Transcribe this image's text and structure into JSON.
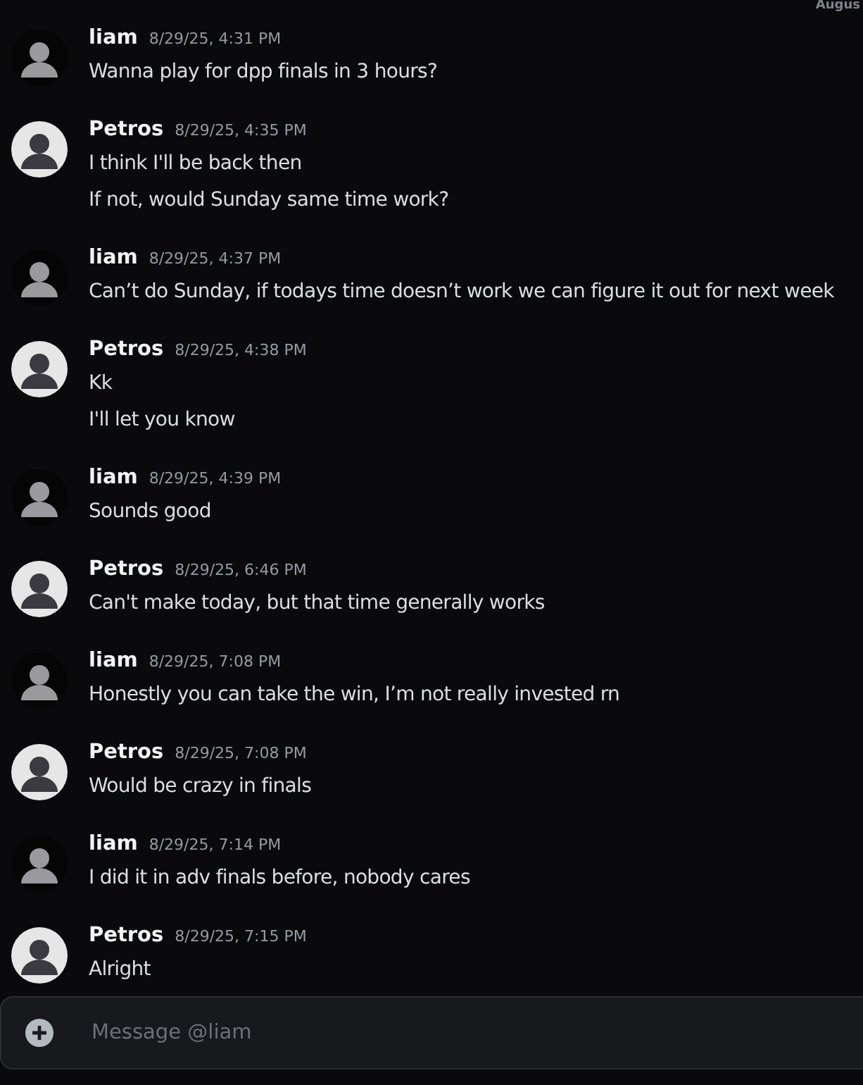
{
  "date_divider": "Augus",
  "messages": [
    {
      "author": "liam",
      "color": "#050505",
      "timestamp": "8/29/25, 4:31 PM",
      "lines": [
        "Wanna play for dpp finals in 3 hours?"
      ]
    },
    {
      "author": "Petros",
      "color": "#e6e6e6",
      "timestamp": "8/29/25, 4:35 PM",
      "lines": [
        "I think I'll be back then",
        "If not, would Sunday same time work?"
      ]
    },
    {
      "author": "liam",
      "color": "#050505",
      "timestamp": "8/29/25, 4:37 PM",
      "lines": [
        "Can’t do Sunday, if todays time doesn’t work we can figure it out for next week"
      ]
    },
    {
      "author": "Petros",
      "color": "#e6e6e6",
      "timestamp": "8/29/25, 4:38 PM",
      "lines": [
        "Kk",
        "I'll let you know"
      ]
    },
    {
      "author": "liam",
      "color": "#050505",
      "timestamp": "8/29/25, 4:39 PM",
      "lines": [
        "Sounds good"
      ]
    },
    {
      "author": "Petros",
      "color": "#e6e6e6",
      "timestamp": "8/29/25, 6:46 PM",
      "lines": [
        "Can't make today, but that time generally works"
      ]
    },
    {
      "author": "liam",
      "color": "#050505",
      "timestamp": "8/29/25, 7:08 PM",
      "lines": [
        "Honestly you can take the win, I’m not really invested rn"
      ]
    },
    {
      "author": "Petros",
      "color": "#e6e6e6",
      "timestamp": "8/29/25, 7:08 PM",
      "lines": [
        "Would be crazy in finals"
      ]
    },
    {
      "author": "liam",
      "color": "#050505",
      "timestamp": "8/29/25, 7:14 PM",
      "lines": [
        "I did it in adv finals before, nobody cares"
      ]
    },
    {
      "author": "Petros",
      "color": "#e6e6e6",
      "timestamp": "8/29/25, 7:15 PM",
      "lines": [
        "Alright"
      ]
    }
  ],
  "composer": {
    "placeholder": "Message @liam"
  }
}
